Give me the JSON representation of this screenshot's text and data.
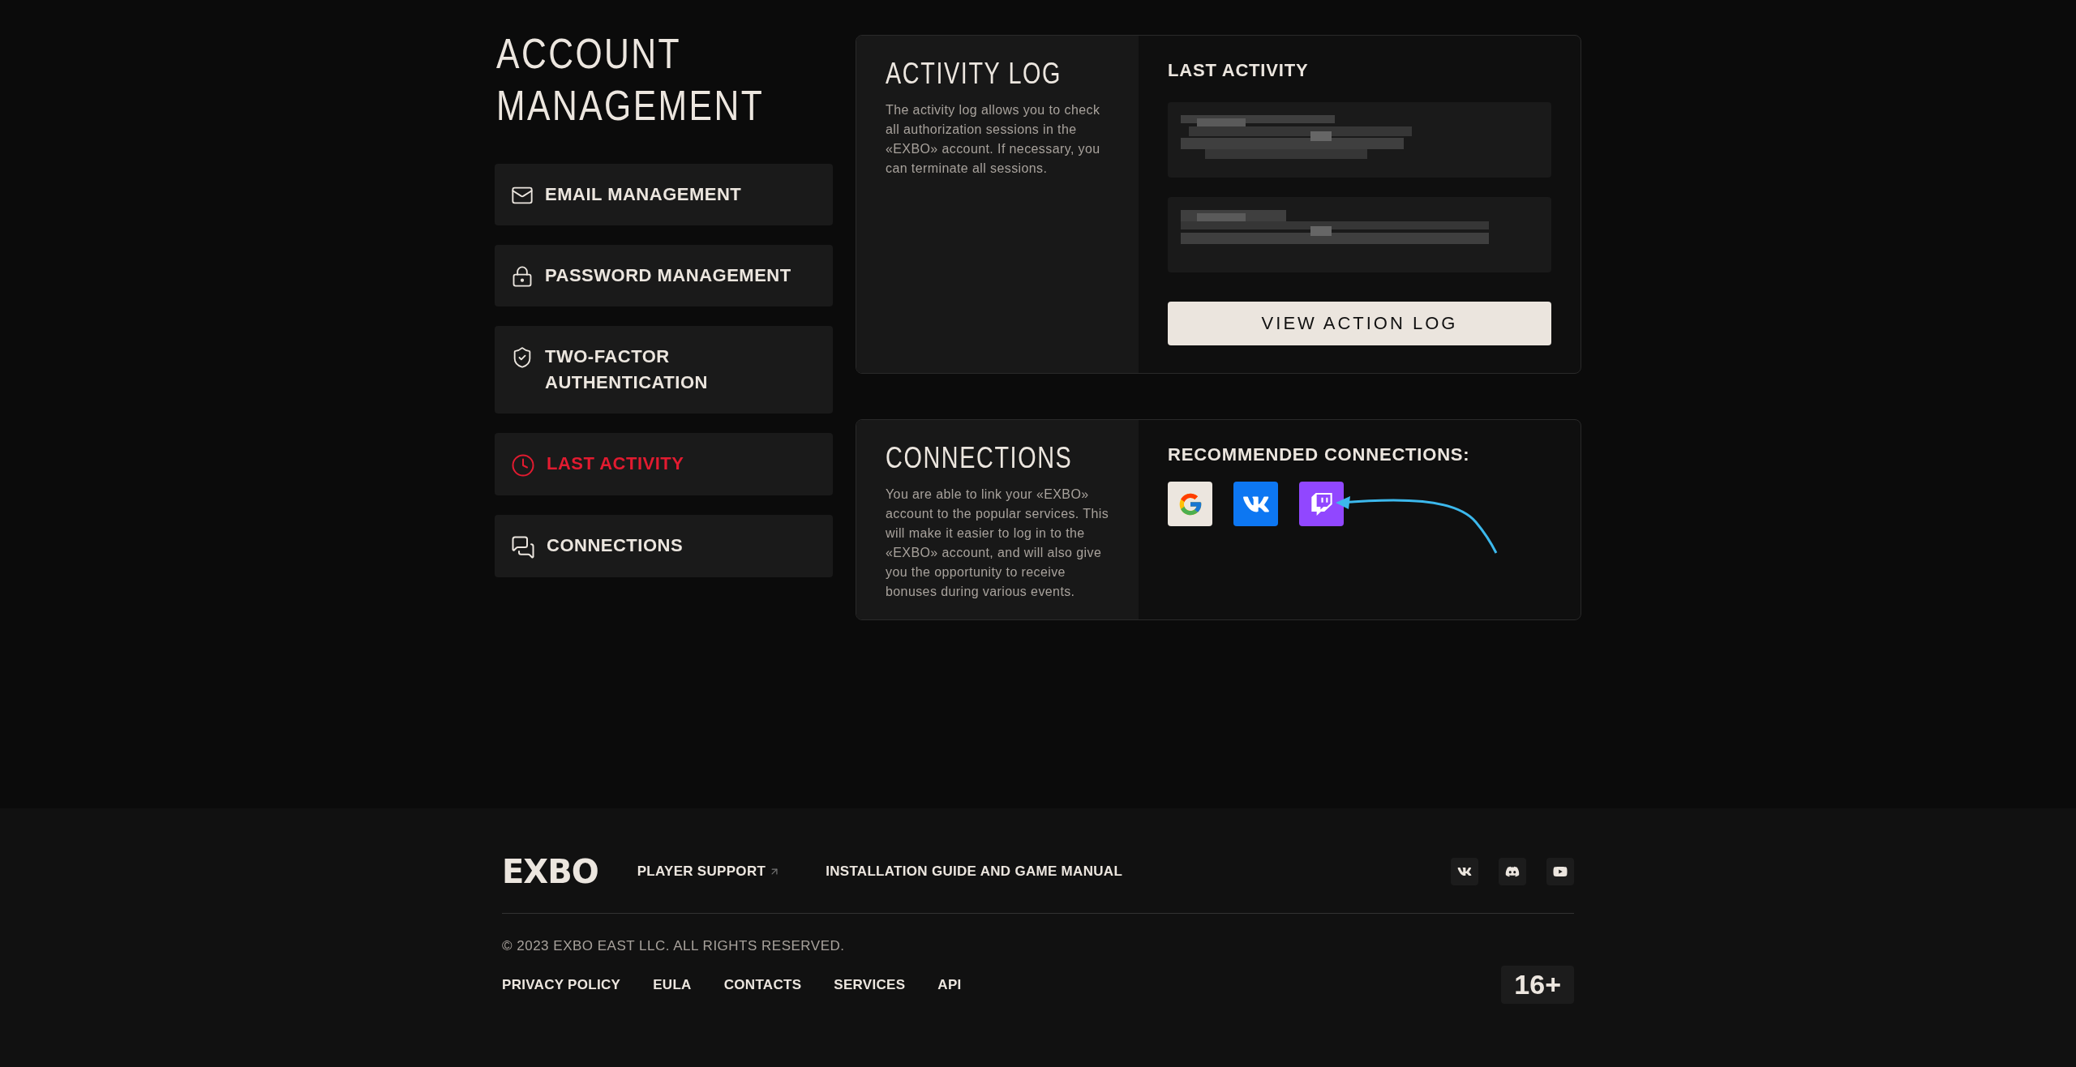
{
  "page_title": "ACCOUNT MANAGEMENT",
  "sidebar": {
    "items": [
      {
        "kind": "email",
        "label": "EMAIL MANAGEMENT",
        "selected": false
      },
      {
        "kind": "password",
        "label": "PASSWORD MANAGEMENT",
        "selected": false
      },
      {
        "kind": "twofactor",
        "label": "TWO-FACTOR AUTHENTICATION",
        "selected": false
      },
      {
        "kind": "activity",
        "label": "LAST ACTIVITY",
        "selected": true
      },
      {
        "kind": "connections",
        "label": "CONNECTIONS",
        "selected": false
      }
    ]
  },
  "activity_log": {
    "title": "ACTIVITY LOG",
    "description": "The activity log allows you to check all authorization sessions in the «EXBO» account. If necessary, you can terminate all sessions.",
    "heading": "LAST ACTIVITY",
    "button": "VIEW ACTION LOG"
  },
  "connections": {
    "title": "CONNECTIONS",
    "description": "You are able to link your «EXBO» account to the popular services. This will make it easier to log in to the «EXBO» account, and will also give you the opportunity to receive bonuses during various events.",
    "heading": "RECOMMENDED CONNECTIONS:",
    "services": [
      {
        "kind": "google"
      },
      {
        "kind": "vk"
      },
      {
        "kind": "twitch"
      }
    ]
  },
  "footer": {
    "logo": "EXBO",
    "links": [
      {
        "label": "PLAYER SUPPORT",
        "external": true
      },
      {
        "label": "INSTALLATION GUIDE AND GAME MANUAL",
        "external": false
      }
    ],
    "socials": [
      {
        "kind": "vk"
      },
      {
        "kind": "discord"
      },
      {
        "kind": "youtube"
      }
    ],
    "copyright": "© 2023 EXBO EAST LLC. ALL RIGHTS RESERVED.",
    "bottom_links": [
      "PRIVACY POLICY",
      "EULA",
      "CONTACTS",
      "SERVICES",
      "API"
    ],
    "age_rating": "16+"
  }
}
